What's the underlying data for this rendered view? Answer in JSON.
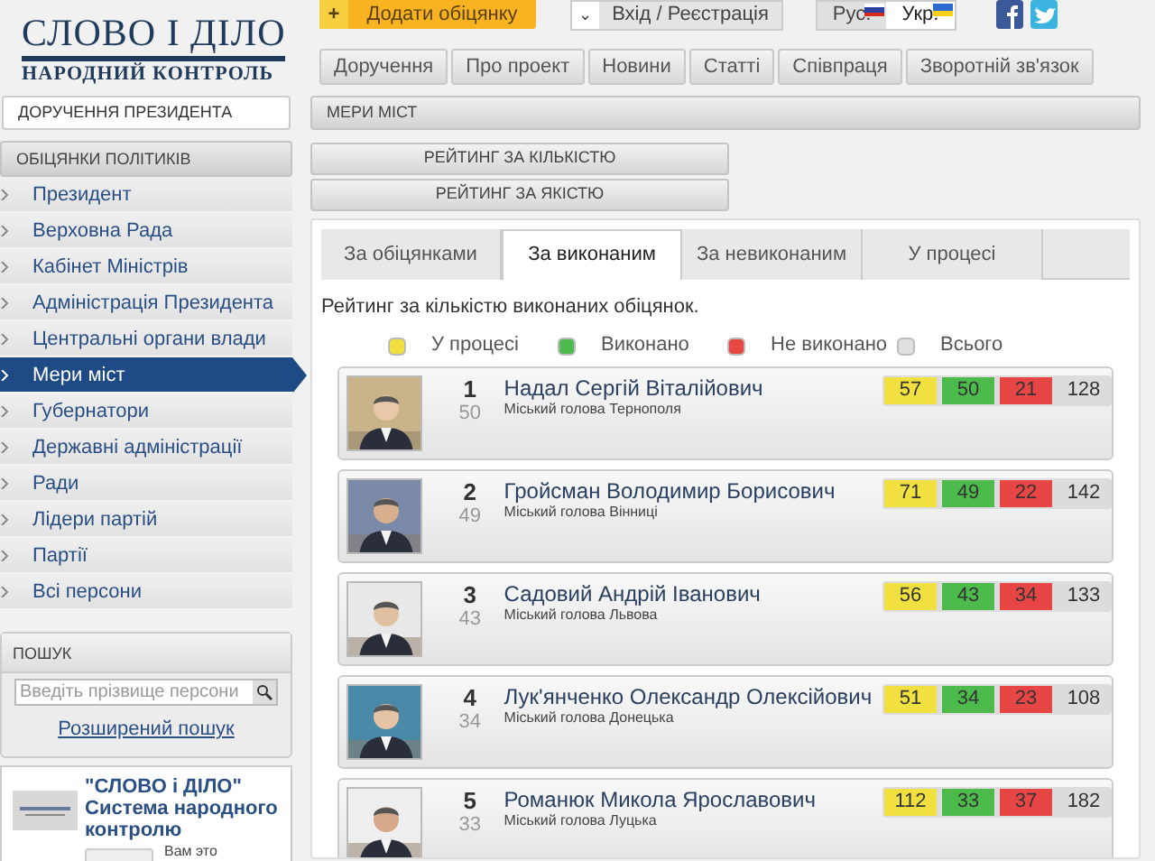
{
  "header": {
    "logo_title": "СЛОВО І ДІЛО",
    "logo_subtitle": "НАРОДНИЙ КОНТРОЛЬ",
    "add_button": {
      "icon": "+",
      "label": "Додати обіцянку"
    },
    "login": {
      "caret": "⌄",
      "label": "Вхід / Реєстрація"
    },
    "languages": [
      {
        "label": "Рус.",
        "selected": false
      },
      {
        "label": "Укр.",
        "selected": true
      }
    ],
    "nav": [
      "Доручення",
      "Про проект",
      "Новини",
      "Статті",
      "Співпраця",
      "Зворотній зв'язок"
    ]
  },
  "sidebar": {
    "top_link": "ДОРУЧЕННЯ ПРЕЗИДЕНТА",
    "section_title": "ОБІЦЯНКИ ПОЛІТИКІВ",
    "items": [
      {
        "label": "Президент",
        "selected": false
      },
      {
        "label": "Верховна Рада",
        "selected": false
      },
      {
        "label": "Кабінет Міністрів",
        "selected": false
      },
      {
        "label": "Адміністрація Президента",
        "selected": false
      },
      {
        "label": "Центральні органи влади",
        "selected": false
      },
      {
        "label": "Мери міст",
        "selected": true
      },
      {
        "label": "Губернатори",
        "selected": false
      },
      {
        "label": "Державні адміністрації",
        "selected": false
      },
      {
        "label": "Ради",
        "selected": false
      },
      {
        "label": "Лідери партій",
        "selected": false
      },
      {
        "label": "Партії",
        "selected": false
      },
      {
        "label": "Всі персони",
        "selected": false
      }
    ],
    "search": {
      "title": "ПОШУК",
      "placeholder": "Введіть прізвище персони",
      "advanced_link": "Розширений пошук"
    },
    "widget": {
      "title": "\"СЛОВО і ДІЛО\" Система народного контролю",
      "note": "Вам это"
    }
  },
  "main": {
    "breadcrumb": "МЕРИ МІСТ",
    "rating_buttons": [
      "РЕЙТИНГ ЗА КІЛЬКІСТЮ",
      "РЕЙТИНГ ЗА ЯКІСТЮ"
    ],
    "tabs": [
      {
        "label": "За обіцянками",
        "selected": false
      },
      {
        "label": "За виконаним",
        "selected": true
      },
      {
        "label": "За невиконаним",
        "selected": false
      },
      {
        "label": "У процесі",
        "selected": false
      }
    ],
    "description": "Рейтинг за кількістю виконаних обіцянок.",
    "legend": [
      {
        "label": "У процесі",
        "color": "#f0e040"
      },
      {
        "label": "Виконано",
        "color": "#4cbb4c"
      },
      {
        "label": "Не виконано",
        "color": "#e84545"
      },
      {
        "label": "Всього",
        "color": "#e0e0e0"
      }
    ],
    "rows": [
      {
        "rank": "1",
        "score": "50",
        "name": "Надал Сергій Віталійович",
        "position": "Міський голова Тернополя",
        "counts": [
          "57",
          "50",
          "21",
          "128"
        ]
      },
      {
        "rank": "2",
        "score": "49",
        "name": "Гройсман Володимир Борисович",
        "position": "Міський голова Вінниці",
        "counts": [
          "71",
          "49",
          "22",
          "142"
        ]
      },
      {
        "rank": "3",
        "score": "43",
        "name": "Садовий Андрій Іванович",
        "position": "Міський голова Львова",
        "counts": [
          "56",
          "43",
          "34",
          "133"
        ]
      },
      {
        "rank": "4",
        "score": "34",
        "name": "Лук'янченко Олександр Олексійович",
        "position": "Міський голова Донецька",
        "counts": [
          "51",
          "34",
          "23",
          "108"
        ]
      },
      {
        "rank": "5",
        "score": "33",
        "name": "Романюк Микола Ярославович",
        "position": "Міський голова Луцька",
        "counts": [
          "112",
          "33",
          "37",
          "182"
        ]
      }
    ]
  }
}
